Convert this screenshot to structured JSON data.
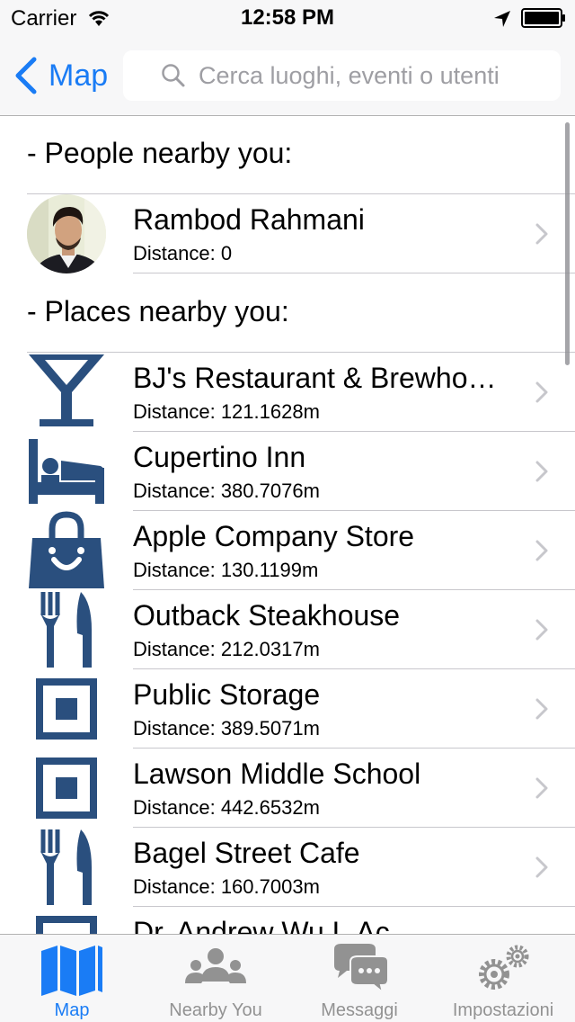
{
  "status_bar": {
    "carrier": "Carrier",
    "time": "12:58 PM"
  },
  "nav": {
    "back_label": "Map",
    "search_placeholder": "Cerca luoghi, eventi o utenti"
  },
  "people_section": {
    "header": "- People nearby you:",
    "items": [
      {
        "name": "Rambod Rahmani",
        "distance": "Distance: 0",
        "icon": "user-avatar"
      }
    ]
  },
  "places_section": {
    "header": "- Places nearby you:",
    "items": [
      {
        "name": "BJ's Restaurant & Brewhouse",
        "distance": "Distance: 121.1628m",
        "icon": "cocktail-icon"
      },
      {
        "name": "Cupertino Inn",
        "distance": "Distance: 380.7076m",
        "icon": "bed-icon"
      },
      {
        "name": "Apple Company Store",
        "distance": "Distance: 130.1199m",
        "icon": "shopping-bag-icon"
      },
      {
        "name": "Outback Steakhouse",
        "distance": "Distance: 212.0317m",
        "icon": "fork-knife-icon"
      },
      {
        "name": "Public Storage",
        "distance": "Distance: 389.5071m",
        "icon": "square-icon"
      },
      {
        "name": "Lawson Middle School",
        "distance": "Distance: 442.6532m",
        "icon": "square-icon"
      },
      {
        "name": "Bagel Street Cafe",
        "distance": "Distance: 160.7003m",
        "icon": "fork-knife-icon"
      },
      {
        "name": "Dr. Andrew Wu L.Ac",
        "distance": "",
        "icon": "square-icon"
      }
    ]
  },
  "tab_bar": {
    "tabs": [
      {
        "label": "Map",
        "icon": "map-icon",
        "active": true
      },
      {
        "label": "Nearby You",
        "icon": "people-icon",
        "active": false
      },
      {
        "label": "Messaggi",
        "icon": "chat-bubbles-icon",
        "active": false
      },
      {
        "label": "Impostazioni",
        "icon": "gears-icon",
        "active": false
      }
    ]
  },
  "colors": {
    "accent": "#1a7cf5",
    "icon_blue": "#2a4f7e",
    "bar_bg": "#f7f7f8",
    "tab_inactive": "#929292"
  }
}
